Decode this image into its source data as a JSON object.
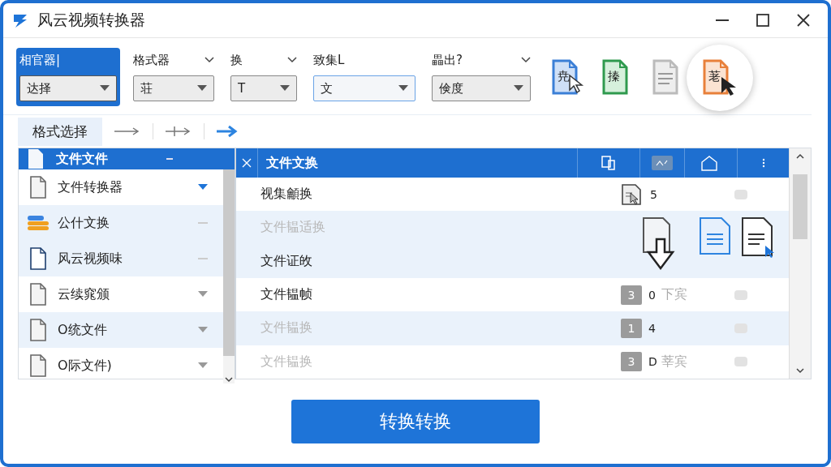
{
  "window": {
    "title": "风云视频转换器"
  },
  "toolbar": {
    "groups": [
      {
        "label": "相官器|",
        "value": "达择",
        "selected": true,
        "chevron": false
      },
      {
        "label": "格式器",
        "value": "荘",
        "selected": false,
        "chevron": true
      },
      {
        "label": "换",
        "value": "T",
        "selected": false,
        "chevron": true
      },
      {
        "label": "致集L",
        "value": "文",
        "selected": false,
        "chevron": false
      },
      {
        "label": "畾出?",
        "value": "倹度",
        "selected": false,
        "chevron": true
      }
    ],
    "tools": [
      {
        "kind": "blue",
        "glyph": "尭"
      },
      {
        "kind": "green",
        "glyph": "搸"
      },
      {
        "kind": "grey"
      },
      {
        "kind": "orange",
        "glyph": "荖"
      }
    ]
  },
  "tabs": [
    {
      "label": "格式选择",
      "selected": true
    }
  ],
  "file_list": {
    "header": "文件文件",
    "items": [
      {
        "name": "文件转换器",
        "kind": "doc",
        "selected": false,
        "expandable": true,
        "active": true
      },
      {
        "name": "公什文换",
        "kind": "stack",
        "selected": true,
        "expandable": false,
        "active": false
      },
      {
        "name": "风云视频味",
        "kind": "outline",
        "selected": true,
        "expandable": false,
        "active": false
      },
      {
        "name": "云续窕颁",
        "kind": "doc",
        "selected": false,
        "expandable": true,
        "active": false
      },
      {
        "name": "O统文件",
        "kind": "doc",
        "selected": true,
        "expandable": true,
        "active": false
      },
      {
        "name": "O际文件)",
        "kind": "doc",
        "selected": false,
        "expandable": true,
        "active": false
      }
    ]
  },
  "table": {
    "header": "文件文换",
    "rows": [
      {
        "name": "视集龥换",
        "disabled": false,
        "selected": false,
        "kind": "icon",
        "count": "5",
        "toggle": true
      },
      {
        "name": "文件韫适换",
        "disabled": true,
        "selected": true,
        "toggle": false
      },
      {
        "name": "文件证敀",
        "disabled": false,
        "selected": true,
        "toggle": false
      },
      {
        "name": "文件韫帧",
        "disabled": false,
        "selected": false,
        "kind": "number",
        "badge": "3",
        "count": "0",
        "note": "下宾",
        "toggle": true
      },
      {
        "name": "文件韫换",
        "disabled": true,
        "selected": true,
        "kind": "number",
        "badge": "1",
        "count": "4",
        "toggle": true
      },
      {
        "name": "文件韫换",
        "disabled": true,
        "selected": false,
        "kind": "number",
        "badge": "3",
        "count": "D",
        "note": "莘宾",
        "toggle": true
      }
    ]
  },
  "convert_button": {
    "label": "转换转换"
  }
}
